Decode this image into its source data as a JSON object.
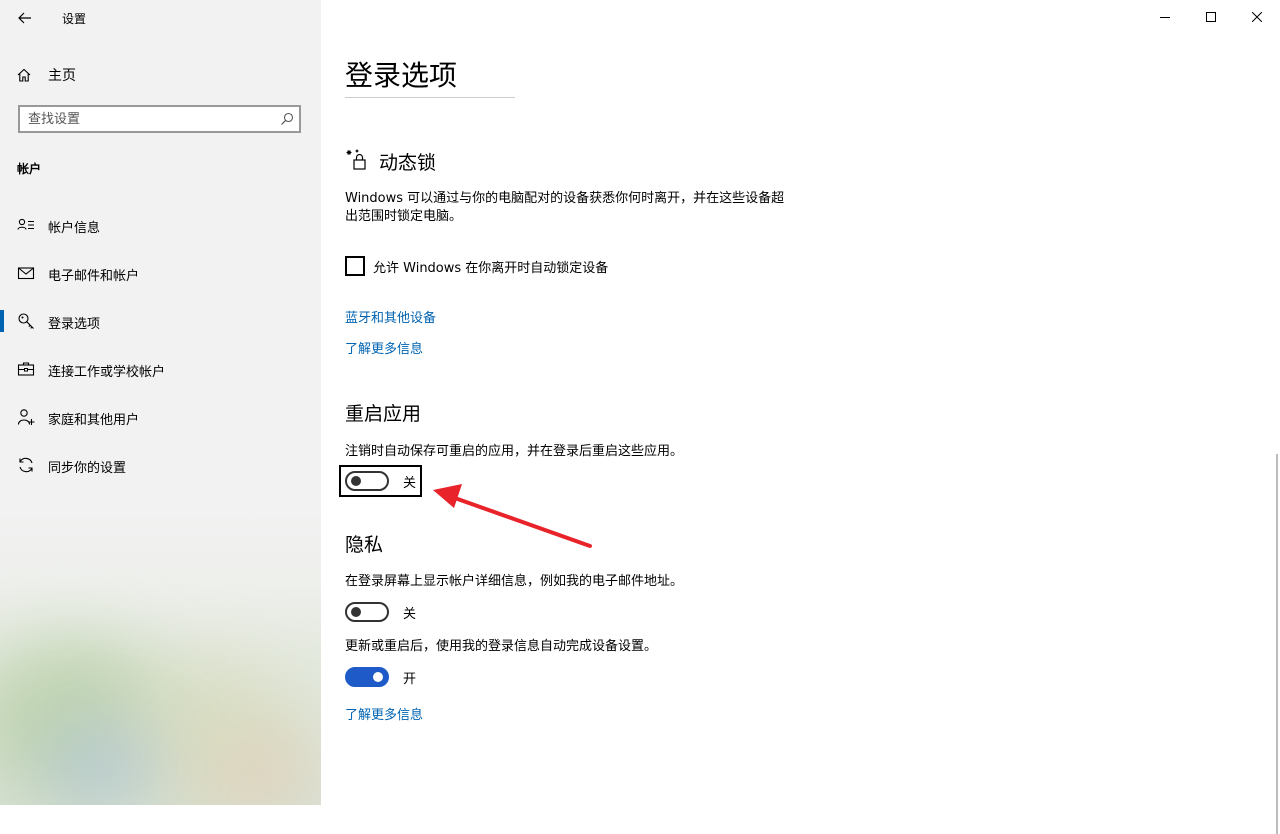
{
  "window": {
    "app_title": "设置"
  },
  "sidebar": {
    "home_label": "主页",
    "search_placeholder": "查找设置",
    "section_label": "帐户",
    "items": [
      {
        "label": "帐户信息",
        "icon": "person-card-icon"
      },
      {
        "label": "电子邮件和帐户",
        "icon": "mail-icon"
      },
      {
        "label": "登录选项",
        "icon": "key-icon",
        "active": true
      },
      {
        "label": "连接工作或学校帐户",
        "icon": "briefcase-icon"
      },
      {
        "label": "家庭和其他用户",
        "icon": "add-person-icon"
      },
      {
        "label": "同步你的设置",
        "icon": "sync-icon"
      }
    ]
  },
  "main": {
    "page_title": "登录选项",
    "dynamic_lock": {
      "heading": "动态锁",
      "icon": "dynamic-lock-icon",
      "description": "Windows 可以通过与你的电脑配对的设备获悉你何时离开，并在这些设备超出范围时锁定电脑。",
      "checkbox_label": "允许 Windows 在你离开时自动锁定设备",
      "checkbox_checked": false,
      "link_bluetooth": "蓝牙和其他设备",
      "link_learn_more": "了解更多信息"
    },
    "restart_apps": {
      "heading": "重启应用",
      "description": "注销时自动保存可重启的应用，并在登录后重启这些应用。",
      "toggle_state": "关",
      "toggle_on": false
    },
    "privacy": {
      "heading": "隐私",
      "show_details_text": "在登录屏幕上显示帐户详细信息，例如我的电子邮件地址。",
      "show_details_state": "关",
      "show_details_on": false,
      "auto_finish_text": "更新或重启后，使用我的登录信息自动完成设备设置。",
      "auto_finish_state": "开",
      "auto_finish_on": true,
      "link_learn_more": "了解更多信息"
    }
  },
  "colors": {
    "accent": "#1e5ac8",
    "link": "#0063b1",
    "annotation_arrow": "#e8232a"
  }
}
